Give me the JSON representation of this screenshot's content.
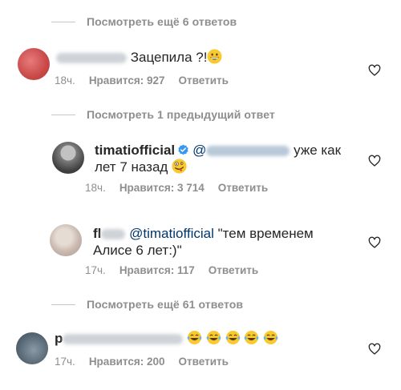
{
  "thread1": {
    "label": "Посмотреть ещё 6 ответов"
  },
  "c1": {
    "text": "Зацепила ?!",
    "time": "18ч.",
    "likes": "Нравится: 927",
    "reply": "Ответить"
  },
  "thread2": {
    "label": "Посмотреть 1 предыдущий ответ"
  },
  "c2": {
    "username": "timatiofficial",
    "text1": "уже как",
    "text2": "лет 7 назад",
    "time": "18ч.",
    "likes": "Нравится: 3 714",
    "reply": "Ответить"
  },
  "c3": {
    "username_prefix": "fl",
    "mention": "@timatiofficial",
    "text1": "\"тем временем",
    "text2": "Алисе 6 лет:)\"",
    "time": "17ч.",
    "likes": "Нравится: 117",
    "reply": "Ответить"
  },
  "thread3": {
    "label": "Посмотреть ещё 61 ответов"
  },
  "c4": {
    "username_prefix": "p",
    "time": "17ч.",
    "likes": "Нравится: 200",
    "reply": "Ответить"
  },
  "icons": {
    "heart": "heart-outline-icon",
    "verified": "verified-badge-icon",
    "grin": "grinning-emoji",
    "zany": "zany-face-emoji",
    "laugh": "tears-of-joy-emoji"
  },
  "colors": {
    "text": "#262626",
    "muted": "#8e8e8e",
    "mention": "#00376b",
    "verified": "#3897f0"
  }
}
